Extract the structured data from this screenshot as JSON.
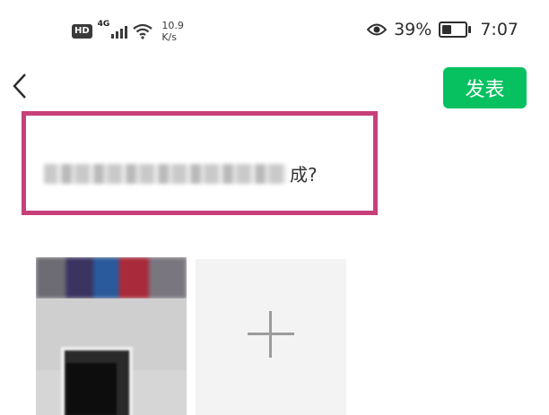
{
  "status_bar": {
    "hd": "HD",
    "network": "4G",
    "speed_value": "10.9",
    "speed_unit": "K/s",
    "battery": "39%",
    "battery_level": 0.39,
    "time": "7:07",
    "icons": [
      "signal-icon",
      "wifi-icon",
      "eye-icon",
      "battery-icon"
    ]
  },
  "header": {
    "back_icon": "chevron-left-icon",
    "publish_label": "发表",
    "accent_color": "#07c160"
  },
  "post": {
    "visible_text": "成?",
    "highlight_color": "#c7407a"
  },
  "media": {
    "add_icon": "plus-icon"
  }
}
